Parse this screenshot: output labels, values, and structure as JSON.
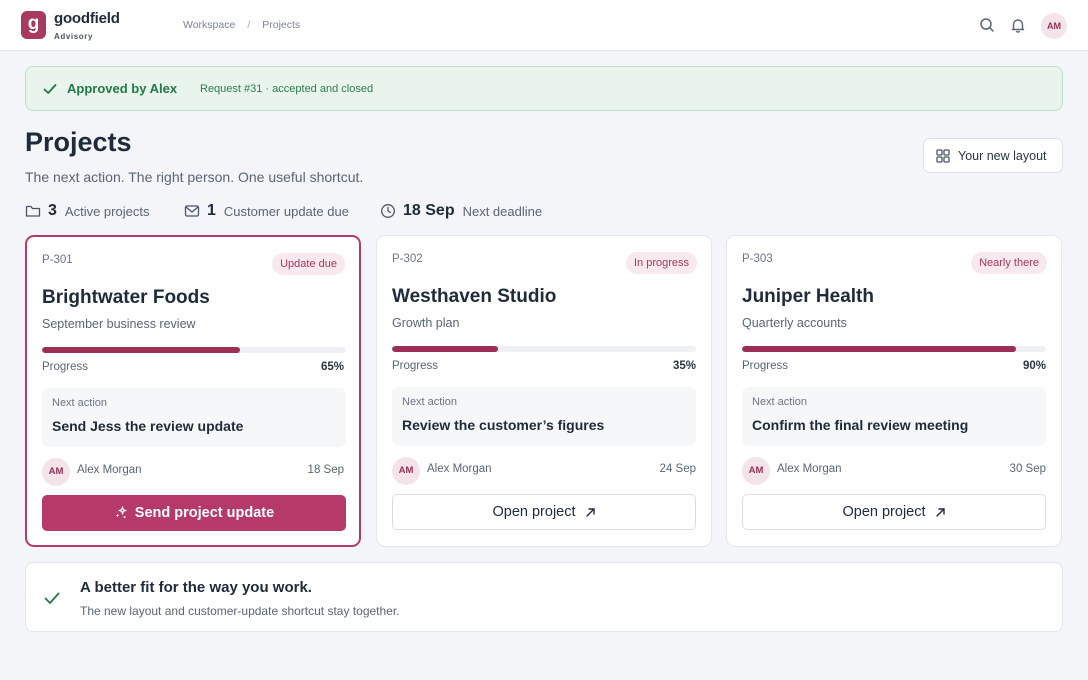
{
  "header": {
    "logo_letter": "g",
    "brand_name": "goodfield",
    "brand_sub": "Advisory",
    "breadcrumb": [
      "Workspace",
      "Projects"
    ],
    "breadcrumb_sep": "/",
    "user_initials": "AM",
    "icons": [
      "search-icon",
      "bell-icon"
    ]
  },
  "banner": {
    "title": "Approved by Alex",
    "detail": "Request #31 · accepted and closed",
    "icon": "check-icon"
  },
  "page": {
    "title": "Projects",
    "subtitle": "The next action. The right person. One useful shortcut.",
    "layout_button": "Your new layout"
  },
  "stats": [
    {
      "icon": "folder-icon",
      "value": "3",
      "label": "Active projects"
    },
    {
      "icon": "mail-icon",
      "value": "1",
      "label": "Customer update due"
    },
    {
      "icon": "clock-icon",
      "value": "18 Sep",
      "label": "Next deadline"
    }
  ],
  "cards": [
    {
      "code": "P-301",
      "status": "Update due",
      "name": "Brightwater Foods",
      "description": "September business review",
      "progress_label": "Progress",
      "progress": 65,
      "progress_text": "65%",
      "next_label": "Next action",
      "next_action": "Send Jess the review update",
      "owner_initials": "AM",
      "owner": "Alex Morgan",
      "due": "18 Sep",
      "button": "Send project update",
      "primary": true
    },
    {
      "code": "P-302",
      "status": "In progress",
      "name": "Westhaven Studio",
      "description": "Growth plan",
      "progress_label": "Progress",
      "progress": 35,
      "progress_text": "35%",
      "next_label": "Next action",
      "next_action": "Review the customer’s figures",
      "owner_initials": "AM",
      "owner": "Alex Morgan",
      "due": "24 Sep",
      "button": "Open project",
      "primary": false
    },
    {
      "code": "P-303",
      "status": "Nearly there",
      "name": "Juniper Health",
      "description": "Quarterly accounts",
      "progress_label": "Progress",
      "progress": 90,
      "progress_text": "90%",
      "next_label": "Next action",
      "next_action": "Confirm the final review meeting",
      "owner_initials": "AM",
      "owner": "Alex Morgan",
      "due": "30 Sep",
      "button": "Open project",
      "primary": false
    }
  ],
  "note": {
    "title": "A better fit for the way you work.",
    "body": "The new layout and customer-update shortcut stay together."
  },
  "colors": {
    "brand": "#a83a5f",
    "accent": "#b53a6a",
    "success": "#23784a",
    "progress": "#9b2f55"
  }
}
